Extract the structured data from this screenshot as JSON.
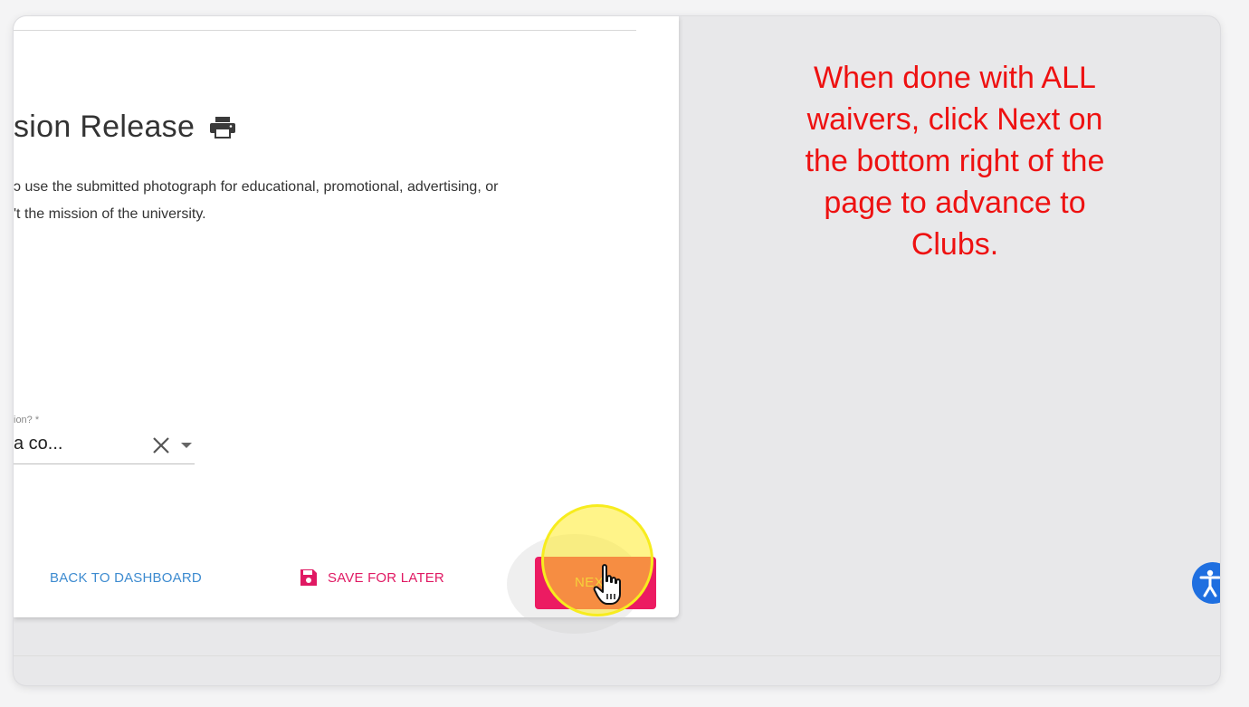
{
  "form": {
    "title_fragment": "sion Release",
    "description_lines": [
      "ɔ use the submitted photograph for educational, promotional, advertising, or",
      "'t the mission of the university."
    ],
    "field_label": "ion? *",
    "field_value": "a co..."
  },
  "actions": {
    "back_label": "BACK TO DASHBOARD",
    "save_label": "SAVE FOR LATER",
    "next_label": "NEXT"
  },
  "annotation": {
    "lines": [
      "When done with ALL",
      "waivers, click Next on",
      "the bottom right of the",
      "page to advance to",
      "Clubs."
    ]
  },
  "icons": {
    "print": "print-icon",
    "clear": "close-icon",
    "dropdown": "caret-down-icon",
    "save": "floppy-disk-icon",
    "cursor": "hand-pointer-icon",
    "accessibility": "accessibility-icon"
  },
  "colors": {
    "next_button": "#ec1b62",
    "save_accent": "#e01963",
    "back_link": "#3d8bd0",
    "annotation_text": "#ee1111",
    "highlight": "#f7ec1e",
    "accessibility_button": "#1f6fe0"
  }
}
